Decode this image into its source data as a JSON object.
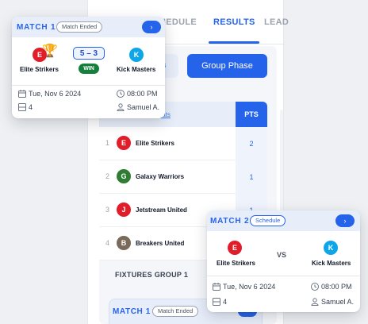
{
  "tabs": [
    {
      "label": "HEDULE"
    },
    {
      "label": "RESULTS"
    },
    {
      "label": "LEAD"
    }
  ],
  "phase": {
    "left_label": "s",
    "active_label": "Group Phase"
  },
  "standings": {
    "stats_link": "tats",
    "pts_header": "PTS",
    "rows": [
      {
        "rank": "1",
        "initial": "E",
        "team": "Elite Strikers",
        "pts": "2"
      },
      {
        "rank": "2",
        "initial": "G",
        "team": "Galaxy Warriors",
        "pts": "1"
      },
      {
        "rank": "3",
        "initial": "J",
        "team": "Jetstream United",
        "pts": "1"
      },
      {
        "rank": "4",
        "initial": "B",
        "team": "Breakers United",
        "pts": ""
      }
    ]
  },
  "fixtures": {
    "title": "FIXTURES GROUP 1",
    "preview_card": {
      "title": "MATCH 1",
      "status": "Match Ended"
    }
  },
  "match1": {
    "title": "MATCH 1",
    "status": "Match Ended",
    "arrow": "›",
    "home": {
      "initial": "E",
      "name": "Elite Strikers"
    },
    "away": {
      "initial": "K",
      "name": "Kick Masters"
    },
    "score": "5 – 3",
    "result": "WIN",
    "date": "Tue, Nov 6 2024",
    "time": "08:00 PM",
    "field": "4",
    "referee": "Samuel A."
  },
  "match2": {
    "title": "MATCH 2",
    "status": "Schedule",
    "arrow": "›",
    "home": {
      "initial": "E",
      "name": "Elite Strikers"
    },
    "away": {
      "initial": "K",
      "name": "Kick Masters"
    },
    "vs": "VS",
    "date": "Tue, Nov 6 2024",
    "time": "08:00 PM",
    "field": "4",
    "referee": "Samuel A."
  },
  "colors": {
    "accent": "#2563eb",
    "win": "#15803d",
    "team_e": "#e11d2a",
    "team_k": "#0ea5e9",
    "team_g": "#2f7d32",
    "team_b": "#7a6a5a"
  }
}
